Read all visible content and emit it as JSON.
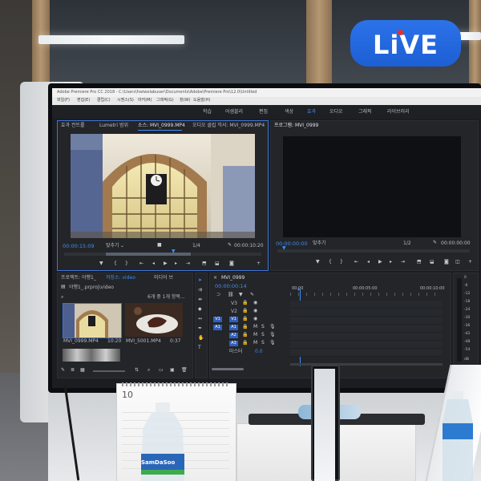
{
  "badge": {
    "text": "LiVE"
  },
  "app": {
    "title_bar": "Adobe Premiere Pro CC 2018 - C:\\Users\\hwiwelabuser\\Documents\\Adobe\\Premiere Pro\\12.0\\Untitled",
    "menu": [
      "파일(F)",
      "편집(E)",
      "클립(C)",
      "시퀀스(S)",
      "마커(M)",
      "그래픽(G)",
      "창(W)",
      "도움말(H)"
    ],
    "workspaces": [
      "학습",
      "어셈블리",
      "편집",
      "색상",
      "효과",
      "오디오",
      "그래픽",
      "라이브러리"
    ],
    "source_tabs": [
      "효과 컨트롤",
      "Lumetri 범위",
      "소스: MVI_0999.MP4",
      "오디오 클립 믹서: MVI_0999.MP4"
    ],
    "source_timecode": "00:00:15:09",
    "source_fit": "맞추기",
    "source_res": "1/4",
    "source_duration": "00:00:10:20",
    "program_tab": "프로그램: MVI_0999",
    "program_timecode": "00:00:00:00",
    "program_fit": "맞추기",
    "program_res": "1/2",
    "program_duration": "00:00:00:00",
    "project_tabs": [
      "프로젝트: 야행1_",
      "저장소: video",
      "미디어 브"
    ],
    "project_path": "야행1_.prproj\\video",
    "item_count": "6개 중 1개 항목...",
    "clips": [
      {
        "name": "MVI_0999.MP4",
        "duration": "10:20"
      },
      {
        "name": "MVI_5001.MP4",
        "duration": "0:37"
      }
    ],
    "timeline_tab": "MVI_0999",
    "timeline_timecode": "00:00:00:14",
    "ruler": [
      "00:00",
      "00:00:05:00",
      "00:00:10:00"
    ],
    "tracks": [
      "V3",
      "V2",
      "V1",
      "A1",
      "A2",
      "A3"
    ],
    "master": "마스터",
    "master_value": "0.0",
    "meter_scale": [
      "0",
      "-6",
      "-12",
      "-18",
      "-24",
      "-30",
      "-36",
      "-42",
      "-48",
      "-54",
      "dB"
    ],
    "colors": {
      "accent_blue": "#3f8df0",
      "badge_blue": "#2267de",
      "badge_dot": "#e3322b"
    }
  },
  "calendar": {
    "day": "10"
  },
  "bottle": {
    "label": "SamDaSoo"
  }
}
